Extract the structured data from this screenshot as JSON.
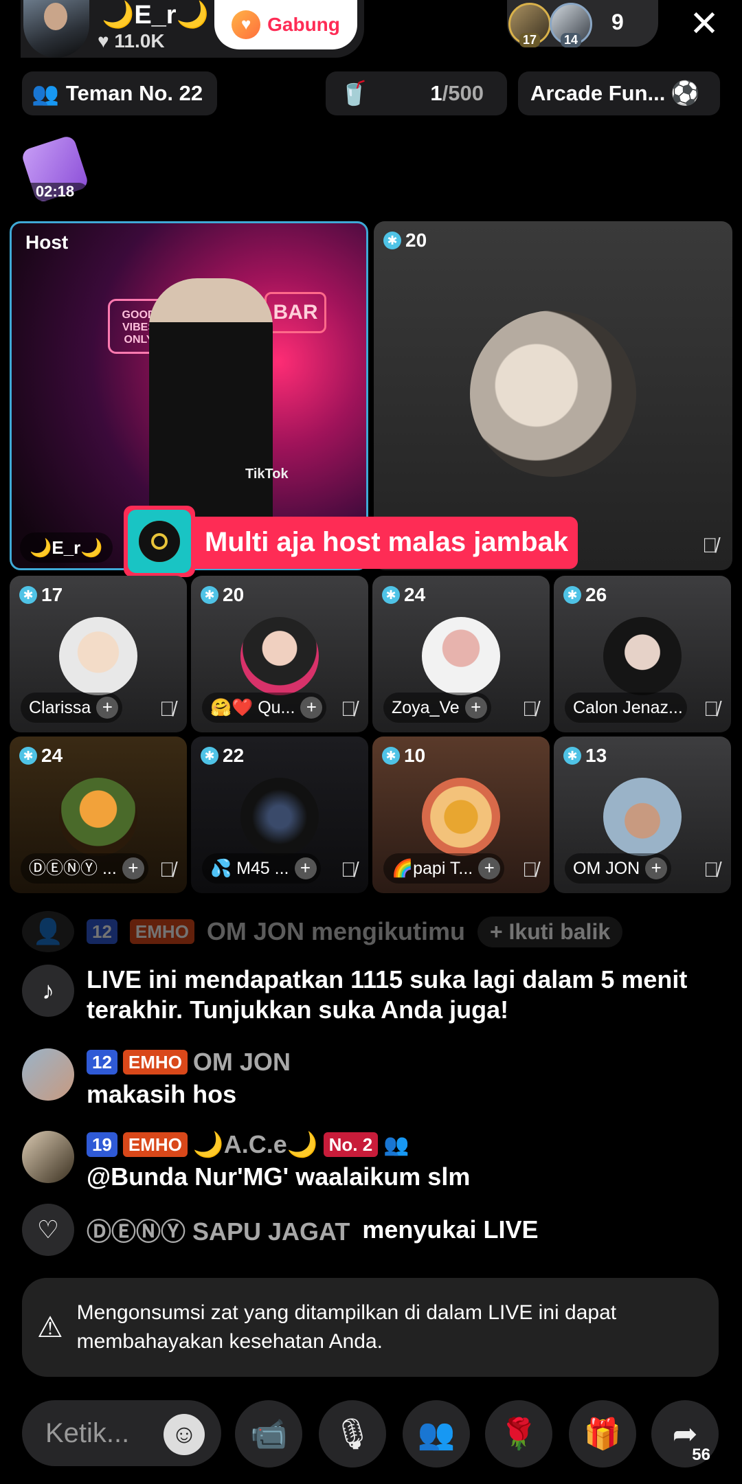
{
  "host": {
    "name": "🌙E_r🌙",
    "likes": "♥ 11.0K",
    "join_label": "Gabung"
  },
  "viewers": {
    "avatars": [
      {
        "level": "17"
      },
      {
        "level": "14"
      }
    ],
    "count": "9",
    "close": "✕"
  },
  "chips": {
    "team": "Teman No. 22",
    "drink_current": "1",
    "drink_total": "/500",
    "arcade": "Arcade Fun..."
  },
  "gift_timer": "02:18",
  "host_tile": {
    "label": "Host",
    "neon_good": "GOOD VIBES ONLY",
    "neon_bar": "BAR",
    "watermark": "TikTok",
    "name": "🌙E_r🌙"
  },
  "guest_big": {
    "level": "20"
  },
  "banner": {
    "text": "Multi aja host malas jambak"
  },
  "guests": [
    {
      "level": "17",
      "name": "Clarissa"
    },
    {
      "level": "20",
      "name": "🤗❤️ Qu..."
    },
    {
      "level": "24",
      "name": "Zoya_Ve"
    },
    {
      "level": "26",
      "name": "Calon Jenaz..."
    },
    {
      "level": "24",
      "name": "ⒹⒺⓃⓎ ..."
    },
    {
      "level": "22",
      "name": "💦 M45 ..."
    },
    {
      "level": "10",
      "name": "🌈papi T..."
    },
    {
      "level": "13",
      "name": "OM JON"
    }
  ],
  "comments": {
    "follow": {
      "level": "12",
      "club": "EMHO",
      "text": "OM JON mengikutimu",
      "action": "+ Ikuti balik"
    },
    "system": "LIVE ini mendapatkan 1115 suka lagi dalam 5 menit terakhir. Tunjukkan suka Anda juga!",
    "c1": {
      "level": "12",
      "club": "EMHO",
      "user": "OM JON",
      "text": "makasih hos"
    },
    "c2": {
      "level": "19",
      "club": "EMHO",
      "user": "🌙A.C.e🌙",
      "rank": "No. 2",
      "text": "@Bunda Nur'MG' waalaikum slm"
    },
    "like": {
      "user": "ⒹⒺⓃⓎ SAPU JAGAT",
      "text": "menyukai LIVE"
    }
  },
  "warning": "Mengonsumsi zat yang ditampilkan di dalam LIVE ini dapat membahayakan kesehatan Anda.",
  "bottom": {
    "input_placeholder": "Ketik...",
    "share_count": "56"
  },
  "colors": {
    "accent": "#fe2c55",
    "host_border": "#3fa9d6",
    "level_badge": "#4fc3e6"
  }
}
